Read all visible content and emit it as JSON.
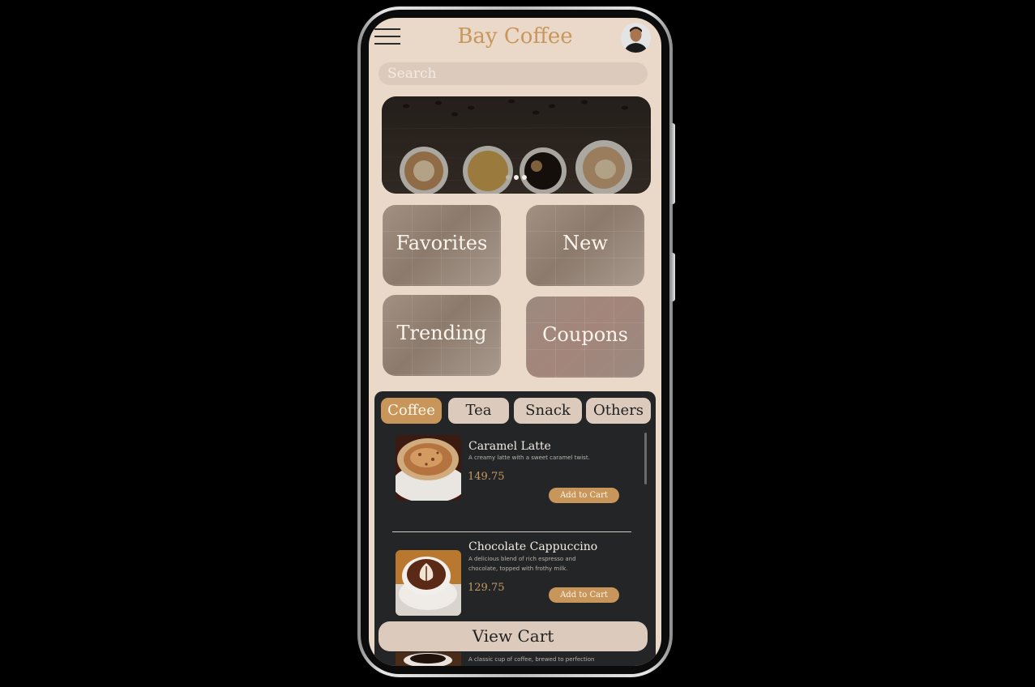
{
  "header": {
    "title": "Bay Coffee"
  },
  "search": {
    "placeholder": "Search"
  },
  "carousel": {
    "slide_count": 3,
    "active_slide": 3
  },
  "quick_links": [
    "Favorites",
    "New",
    "Trending",
    "Coupons"
  ],
  "categories": [
    {
      "label": "Coffee",
      "active": true
    },
    {
      "label": "Tea",
      "active": false
    },
    {
      "label": "Snack",
      "active": false
    },
    {
      "label": "Others",
      "active": false
    }
  ],
  "items": [
    {
      "name": "Caramel Latte",
      "description": "A creamy latte with a sweet caramel twist.",
      "price": "149.75",
      "button": "Add to Cart"
    },
    {
      "name": "Chocolate Cappuccino",
      "description": "A delicious blend of rich espresso and chocolate, topped with frothy milk.",
      "price": "129.75",
      "button": "Add to Cart"
    },
    {
      "name": "",
      "description": "A classic cup of coffee, brewed to perfection"
    }
  ],
  "cart": {
    "label": "View Cart"
  },
  "colors": {
    "accent": "#c8965a",
    "background": "#ead9c9",
    "panel": "#242526",
    "chip": "#dccbbd"
  },
  "icons": {
    "menu": "hamburger-icon",
    "profile": "avatar"
  }
}
